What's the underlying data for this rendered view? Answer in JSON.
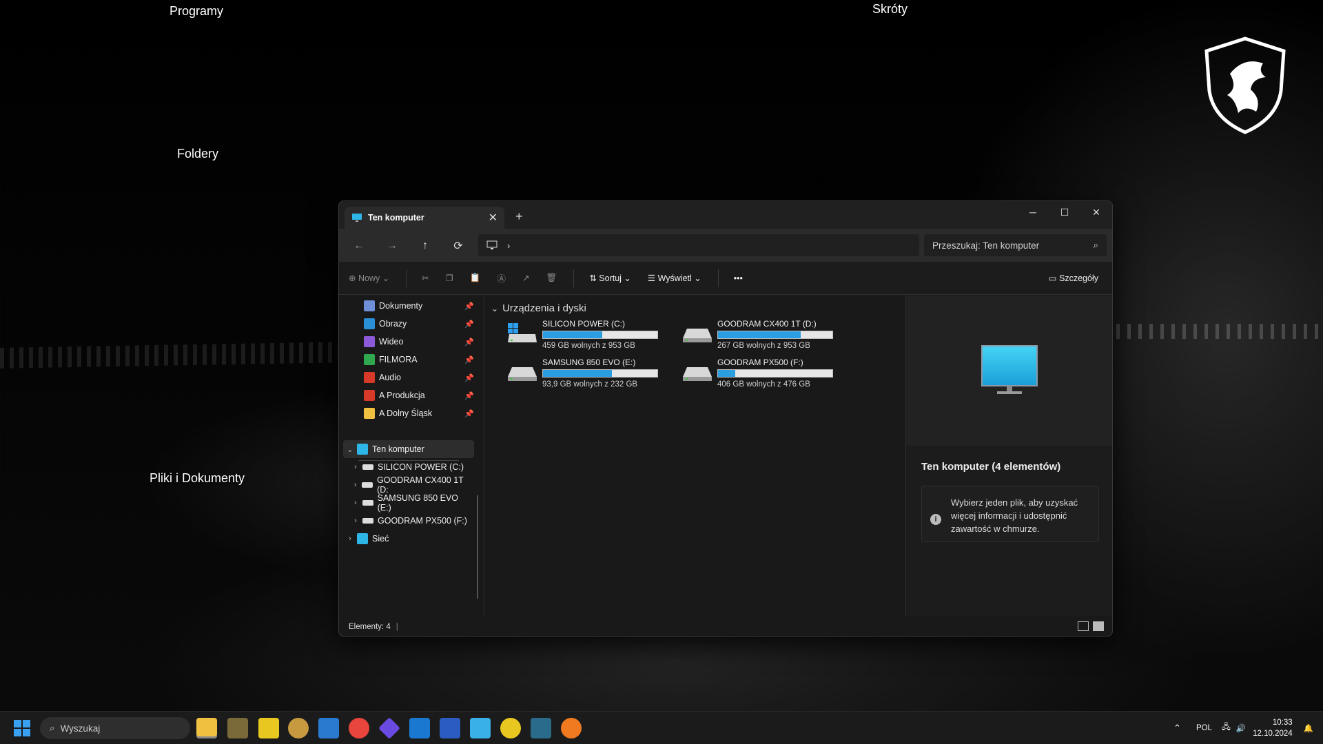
{
  "desktop": {
    "labels": [
      "Programy",
      "Skróty",
      "Foldery",
      "Pliki i Dokumenty"
    ]
  },
  "window": {
    "tab_title": "Ten komputer",
    "search_placeholder": "Przeszukaj: Ten komputer",
    "toolbar": {
      "new_label": "Nowy",
      "sort_label": "Sortuj",
      "view_label": "Wyświetl",
      "details_label": "Szczegóły"
    },
    "sidebar": {
      "pinned": [
        {
          "label": "Dokumenty",
          "color": "#6f8fd8"
        },
        {
          "label": "Obrazy",
          "color": "#2b8fd8"
        },
        {
          "label": "Wideo",
          "color": "#8c5ad8"
        },
        {
          "label": "FILMORA",
          "color": "#2fa84f"
        },
        {
          "label": "Audio",
          "color": "#d83a2a"
        },
        {
          "label": "A Produkcja",
          "color": "#d83a2a"
        },
        {
          "label": "A Dolny Śląsk",
          "color": "#f0c040"
        }
      ],
      "this_pc_label": "Ten komputer",
      "drives": [
        "SILICON POWER (C:)",
        "GOODRAM CX400 1T (D:",
        "SAMSUNG 850 EVO (E:)",
        "GOODRAM PX500 (F:)"
      ],
      "network_label": "Sieć"
    },
    "content": {
      "group_title": "Urządzenia i dyski",
      "drives": [
        {
          "name": "SILICON POWER (C:)",
          "free": "459 GB wolnych z 953 GB",
          "used_fraction": 0.52,
          "icon": "windows-drive-icon"
        },
        {
          "name": "GOODRAM CX400 1T (D:)",
          "free": "267 GB wolnych z 953 GB",
          "used_fraction": 0.72,
          "icon": "drive-icon"
        },
        {
          "name": "SAMSUNG 850 EVO (E:)",
          "free": "93,9 GB wolnych z 232 GB",
          "used_fraction": 0.6,
          "icon": "drive-icon"
        },
        {
          "name": "GOODRAM PX500 (F:)",
          "free": "406 GB wolnych z 476 GB",
          "used_fraction": 0.15,
          "icon": "drive-icon"
        }
      ]
    },
    "details": {
      "title": "Ten komputer (4 elementów)",
      "info": "Wybierz jeden plik, aby uzyskać więcej informacji i udostępnić zawartość w chmurze."
    },
    "status": "Elementy: 4"
  },
  "taskbar": {
    "search_label": "Wyszukaj",
    "language": "POL",
    "time": "10:33",
    "date": "12.10.2024"
  },
  "colors": {
    "accent": "#2a9ee0",
    "window_bg": "#191919"
  }
}
